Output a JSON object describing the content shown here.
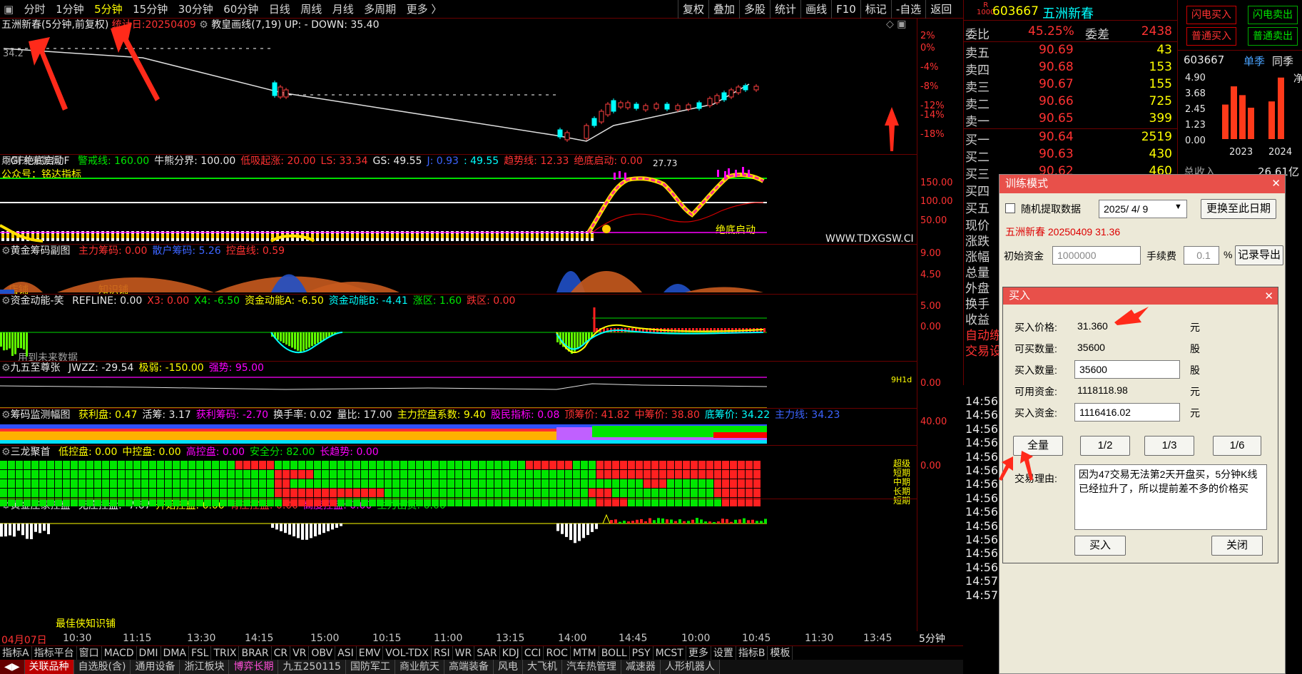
{
  "toolbar": {
    "periods": [
      "分时",
      "1分钟",
      "5分钟",
      "15分钟",
      "30分钟",
      "60分钟",
      "日线",
      "周线",
      "月线",
      "多周期",
      "更多 〉"
    ],
    "active_index": 2,
    "right": [
      "复权",
      "叠加",
      "多股",
      "统计",
      "画线",
      "F10",
      "标记",
      "-自选",
      "返回"
    ]
  },
  "main": {
    "stock_title": "五洲新春(5分钟,前复权)",
    "date_label": "统计日:20250409",
    "indicator": "教皇画线(7,19)",
    "updown": "UP: - DOWN: 35.40",
    "yaxis": [
      "2%",
      "0%",
      "-4%",
      "-8%",
      "-12%",
      "-14%",
      "-18%"
    ],
    "left_price": "34.2",
    "low_price": "27.73",
    "future_note": "用到未来数据"
  },
  "p1": {
    "name": "GF绝底启动F",
    "items": [
      [
        "警戒线: 160.00",
        "grn"
      ],
      [
        "牛熊分界: 100.00",
        "wht"
      ],
      [
        "低吸起涨: 20.00",
        "red"
      ],
      [
        "LS: 33.34",
        "red"
      ],
      [
        "GS: 49.55",
        "wht"
      ],
      [
        "J: 0.93",
        "blu"
      ],
      [
        ": 49.55",
        "cyn"
      ],
      [
        "趋势线: 12.33",
        "red"
      ],
      [
        "绝底启动: 0.00",
        "red"
      ]
    ],
    "sub": "公众号：铭达指标",
    "yaxis": [
      "150.00",
      "100.00",
      "50.00"
    ],
    "startlabel": "绝底启动",
    "watermark": "WWW.TDXGSW.CI"
  },
  "p2": {
    "name": "黄金筹码副图",
    "items": [
      [
        "主力筹码: 0.00",
        "red"
      ],
      [
        "散户筹码: 5.26",
        "blu"
      ],
      [
        "控盘线: 0.59",
        "red"
      ]
    ],
    "yaxis": [
      "9.00",
      "4.50"
    ],
    "sub1": "店铺",
    "sub2": "知识铺"
  },
  "p3": {
    "name": "资金动能-笑",
    "items": [
      [
        "REFLINE: 0.00",
        "wht"
      ],
      [
        "X3: 0.00",
        "red"
      ],
      [
        "X4: -6.50",
        "grn"
      ],
      [
        "资金动能A: -6.50",
        "yel"
      ],
      [
        "资金动能B: -4.41",
        "cyn"
      ],
      [
        "涨区: 1.60",
        "grn"
      ],
      [
        "跌区: 0.00",
        "red"
      ]
    ],
    "yaxis": [
      "5.00",
      "0.00"
    ],
    "future_note": "用到未来数据"
  },
  "p4": {
    "name": "九五至尊张",
    "items": [
      [
        "JWZZ: -29.54",
        "wht"
      ],
      [
        "极弱: -150.00",
        "yel"
      ],
      [
        "强势: 95.00",
        "mag"
      ]
    ],
    "yaxis": [
      "0.00"
    ],
    "tag": "9H1d"
  },
  "p5": {
    "name": "筹码监测幅图",
    "items": [
      [
        "获利盘: 0.47",
        "yel"
      ],
      [
        "活筹: 3.17",
        "wht"
      ],
      [
        "获利筹码: -2.70",
        "mag"
      ],
      [
        "换手率: 0.02",
        "wht"
      ],
      [
        "量比: 17.00",
        "wht"
      ],
      [
        "主力控盘系数: 9.40",
        "yel"
      ],
      [
        "股民指标: 0.08",
        "mag"
      ],
      [
        "顶筹价: 41.82",
        "red"
      ],
      [
        "中筹价: 38.80",
        "red"
      ],
      [
        "底筹价: 34.22",
        "cyn"
      ],
      [
        "主力线: 34.23",
        "blu"
      ]
    ],
    "yaxis": [
      "40.00"
    ]
  },
  "p6": {
    "name": "三龙聚首",
    "items": [
      [
        "低控盘: 0.00",
        "yel"
      ],
      [
        "中控盘: 0.00",
        "yel"
      ],
      [
        "高控盘: 0.00",
        "mag"
      ],
      [
        "安全分: 82.00",
        "grn"
      ],
      [
        "长趋势: 0.00",
        "mag"
      ]
    ],
    "yaxis": [
      "0.00"
    ],
    "labels": [
      "超级",
      "短期",
      "中期",
      "长期",
      "短期"
    ]
  },
  "p7": {
    "name": "黄金庄家控盘",
    "items": [
      [
        "无庄控盘: -7.67",
        "wht"
      ],
      [
        "开始控盘: 0.00",
        "yel"
      ],
      [
        "有庄控盘: 0.00",
        "red"
      ],
      [
        "高度控盘: 0.00",
        "mag"
      ],
      [
        "主力出货: 0.00",
        "grn"
      ]
    ],
    "sub": "最佳侠知识铺"
  },
  "timeaxis": [
    "04月07日",
    "10:30",
    "11:15",
    "13:30",
    "14:15",
    "15:00",
    "10:15",
    "11:00",
    "13:15",
    "14:00",
    "14:45",
    "10:00",
    "10:45",
    "11:30",
    "13:45"
  ],
  "period_label": "5分钟",
  "bottom_tabs": [
    "指标A",
    "指标平台",
    "窗口",
    "MACD",
    "DMI",
    "DMA",
    "FSL",
    "TRIX",
    "BRAR",
    "CR",
    "VR",
    "OBV",
    "ASI",
    "EMV",
    "VOL-TDX",
    "RSI",
    "WR",
    "SAR",
    "KDJ",
    "CCI",
    "ROC",
    "MTM",
    "BOLL",
    "PSY",
    "MCST",
    "更多",
    "设置",
    "指标B",
    "模板"
  ],
  "sector_tabs": [
    "关联品种",
    "自选股(含)",
    "通用设备",
    "浙江板块",
    "博弈长期",
    "九五250115",
    "国防军工",
    "商业航天",
    "高端装备",
    "风电",
    "大飞机",
    "汽车热管理",
    "减速器",
    "人形机器人"
  ],
  "quote": {
    "code": "603667",
    "name": "五洲新春",
    "badge": "R",
    "weibi_label": "委比",
    "weibi": "45.25%",
    "weicha_label": "委差",
    "weicha": "2438",
    "asks": [
      [
        "卖五",
        "90.69",
        "43"
      ],
      [
        "卖四",
        "90.68",
        "153"
      ],
      [
        "卖三",
        "90.67",
        "155"
      ],
      [
        "卖二",
        "90.66",
        "725"
      ],
      [
        "卖一",
        "90.65",
        "399"
      ]
    ],
    "bids": [
      [
        "买一",
        "90.64",
        "2519"
      ],
      [
        "买二",
        "90.63",
        "430"
      ],
      [
        "买三",
        "90.62",
        "460"
      ],
      [
        "买四",
        "",
        ""
      ],
      [
        "买五",
        "",
        ""
      ]
    ],
    "side": [
      "现价",
      "涨跌",
      "涨幅",
      "总量",
      "外盘",
      "换手",
      "收益",
      "自动练",
      "交易设"
    ],
    "times": [
      "14:56",
      "14:56",
      "14:56",
      "14:56",
      "14:56",
      "14:56",
      "14:56",
      "14:56",
      "14:56",
      "14:56",
      "14:56",
      "14:56",
      "14:56",
      "14:57",
      "14:57"
    ]
  },
  "trade_buttons": {
    "flash_buy": "闪电买入",
    "flash_sell": "闪电卖出",
    "normal_buy": "普通买入",
    "normal_sell": "普通卖出"
  },
  "mini": {
    "code": "603667",
    "tab1": "单季",
    "tab2": "同季",
    "tab3": "净",
    "y": [
      "4.90",
      "3.68",
      "2.45",
      "1.23",
      "0.00"
    ],
    "x": [
      "2023",
      "2024"
    ],
    "income_label": "总收入",
    "income": "26.61亿"
  },
  "training": {
    "title": "训练模式",
    "random_label": "随机提取数据",
    "date": "2025/ 4/ 9",
    "change_date": "更换至此日期",
    "info": "五洲新春 20250409 31.36",
    "capital_label": "初始资金",
    "capital": "1000000",
    "fee_label": "手续费",
    "fee": "0.1",
    "pct": "%",
    "export": "记录导出"
  },
  "buy": {
    "title": "买入",
    "price_label": "买入价格:",
    "price": "31.360",
    "unit_yuan": "元",
    "avail_qty_label": "可买数量:",
    "avail_qty": "35600",
    "unit_gu": "股",
    "qty_label": "买入数量:",
    "qty": "35600",
    "cash_label": "可用资金:",
    "cash": "1118118.98",
    "amount_label": "买入资金:",
    "amount": "1116416.02",
    "fractions": [
      "全量",
      "1/2",
      "1/3",
      "1/6"
    ],
    "reason_label": "交易理由:",
    "reason": "因为47交易无法第2天开盘买，5分钟K线已经拉升了，所以提前差不多的价格买",
    "buy": "买入",
    "close": "关闭"
  }
}
